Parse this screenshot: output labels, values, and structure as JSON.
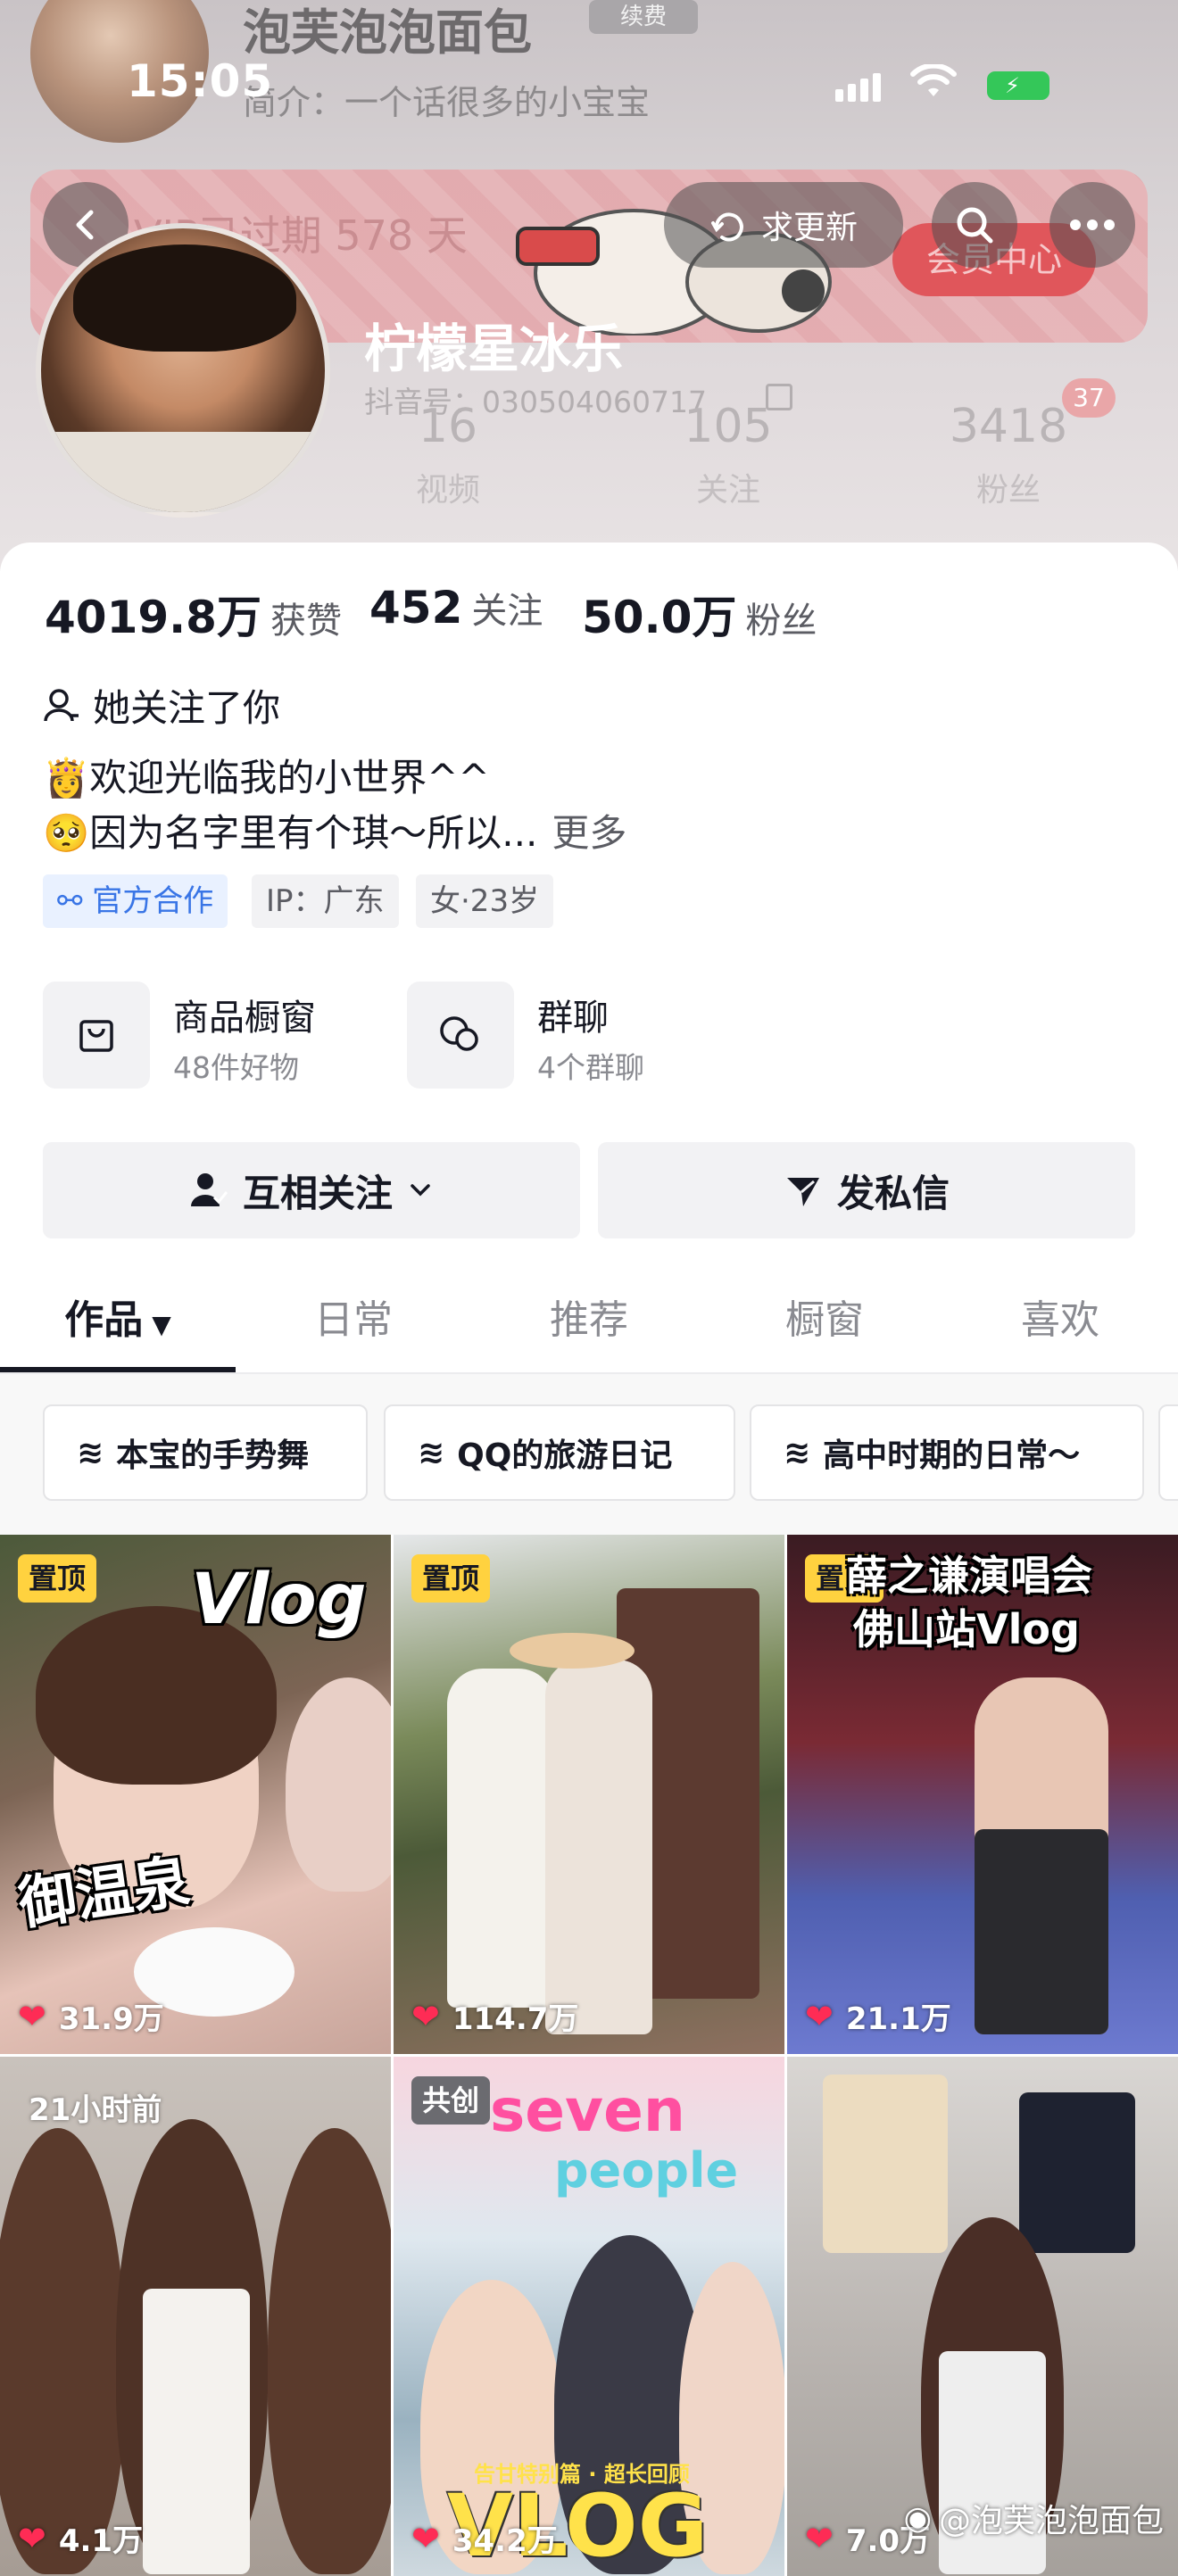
{
  "ghost_header": {
    "name": "泡芙泡泡面包",
    "badge": "续费",
    "intro": "简介：一个话很多的小宝宝"
  },
  "status_bar": {
    "time": "15:05"
  },
  "vip_banner": {
    "text": "VIP已过期 578 天",
    "center": "会员中心"
  },
  "top_bar": {
    "update_label": "求更新"
  },
  "profile": {
    "nickname": "柠檬星冰乐",
    "douyin_id": "抖音号：030504060717",
    "ghost_stats": [
      {
        "value": "16",
        "label": "视频"
      },
      {
        "value": "105",
        "label": "关注"
      },
      {
        "value": "3418",
        "label": "粉丝"
      }
    ],
    "ghost_badge": "37"
  },
  "stats": [
    {
      "value": "4019.8万",
      "label": "获赞"
    },
    {
      "value": "452",
      "label": "关注"
    },
    {
      "value": "50.0万",
      "label": "粉丝"
    }
  ],
  "follow_you": "她关注了你",
  "bio": {
    "line1_emoji": "👸",
    "line1": "欢迎光临我的小世界^^",
    "line2_emoji": "🥺",
    "line2": "因为名字里有个琪～所以...",
    "more": "更多"
  },
  "tags": {
    "official": "官方合作",
    "ip": "IP：广东",
    "gender_age": "女·23岁"
  },
  "features": [
    {
      "title": "商品橱窗",
      "sub": "48件好物",
      "icon": "shopping-bag-icon"
    },
    {
      "title": "群聊",
      "sub": "4个群聊",
      "icon": "chat-bubble-icon"
    }
  ],
  "actions": {
    "mutual_follow": "互相关注",
    "message": "发私信"
  },
  "tabs": [
    "作品",
    "日常",
    "推荐",
    "橱窗",
    "喜欢"
  ],
  "collections": [
    "本宝的手势舞",
    "QQ的旅游日记",
    "高中时期的日常～"
  ],
  "videos": [
    {
      "badge": "置顶",
      "title": "Vlog",
      "caption": "御温泉",
      "likes": "31.9万"
    },
    {
      "badge": "置顶",
      "title": "",
      "caption": "",
      "likes": "114.7万"
    },
    {
      "badge": "置顶",
      "title": "薛之谦演唱会",
      "caption": "佛山站Vlog",
      "likes": "21.1万"
    },
    {
      "badge": "21小时前",
      "title": "",
      "caption": "",
      "likes": "4.1万"
    },
    {
      "badge": "共创",
      "title": "seven",
      "caption": "people",
      "bottom": "VLOG",
      "subcaption": "告甘特别篇 · 超长回顾",
      "likes": "34.2万"
    },
    {
      "badge": "",
      "title": "",
      "caption": "",
      "likes": "7.0万"
    }
  ],
  "watermark": "@泡芙泡泡面包",
  "colors": {
    "accent_blue": "#3975e6",
    "pin_yellow": "#ffd23f",
    "like_red": "#fe2c55",
    "text_primary": "#161823",
    "text_secondary": "#8a8b91"
  }
}
